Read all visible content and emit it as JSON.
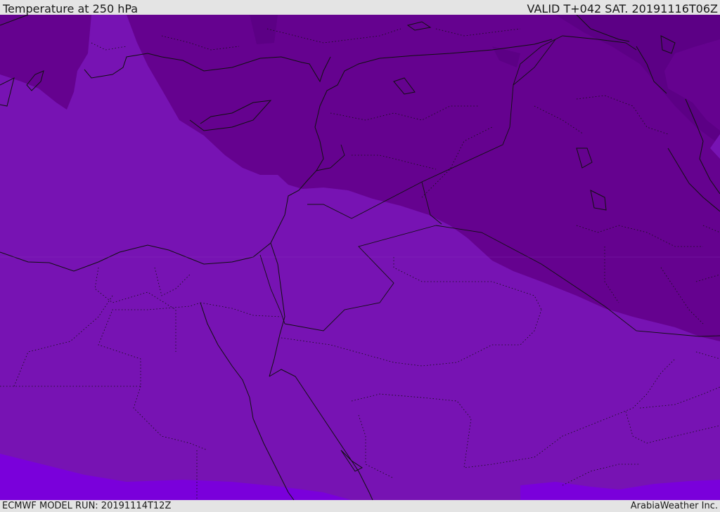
{
  "header": {
    "title": "Temperature at 250 hPa",
    "valid": "VALID T+042 SAT. 20191116T06Z"
  },
  "footer": {
    "model_run": "ECMWF MODEL RUN: 20191114T12Z",
    "credit": "ArabiaWeather Inc."
  },
  "map": {
    "field": "temperature-250hPa",
    "colors": {
      "warm_band": "#7713b3",
      "cold_band": "#65028f",
      "coldest_band": "#5c0085",
      "warmest_band": "#7a00db",
      "borders": "#101010"
    }
  }
}
